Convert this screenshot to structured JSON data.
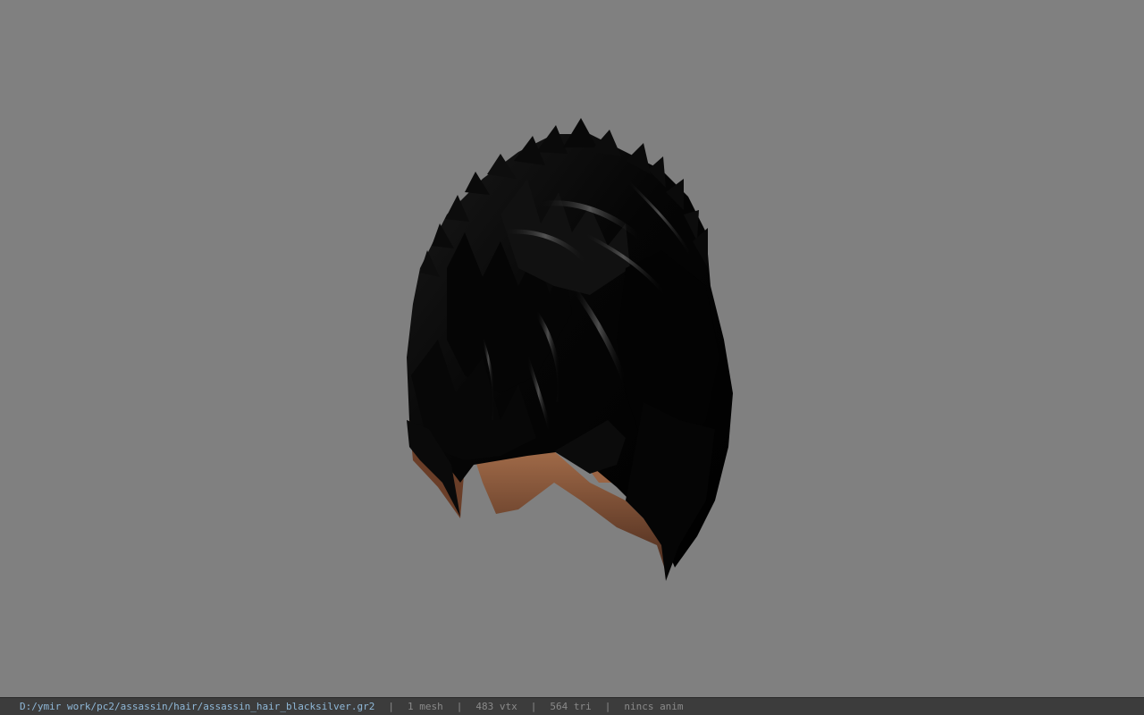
{
  "viewer": {
    "background_color": "#808080",
    "model": {
      "icon": "hair-mesh-model",
      "hair_color": "#0a0a0a",
      "highlight_color": "#6e6e6e",
      "scalp_color": "#8a5a3c"
    }
  },
  "statusbar": {
    "file_path": "D:/ymir work/pc2/assassin/hair/assassin_hair_blacksilver.gr2",
    "separator": "|",
    "mesh_count": "1 mesh",
    "vertex_count": "483 vtx",
    "triangle_count": "564 tri",
    "animation": "nincs anim"
  }
}
